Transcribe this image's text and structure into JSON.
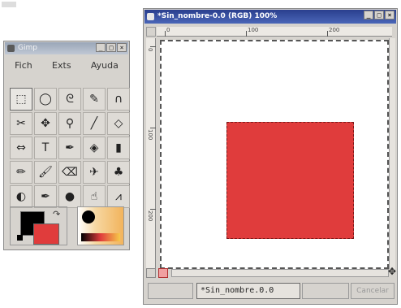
{
  "toolbox": {
    "title": "Gimp",
    "menu": [
      "Fich",
      "Exts",
      "Ayuda"
    ],
    "tools": [
      {
        "icon": "rect-select-icon",
        "glyph": "⬚"
      },
      {
        "icon": "ellipse-select-icon",
        "glyph": "◯"
      },
      {
        "icon": "free-select-icon",
        "glyph": "ᘓ"
      },
      {
        "icon": "fuzzy-select-icon",
        "glyph": "✎"
      },
      {
        "icon": "bezier-select-icon",
        "glyph": "∩"
      },
      {
        "icon": "scissors-icon",
        "glyph": "✂"
      },
      {
        "icon": "move-icon",
        "glyph": "✥"
      },
      {
        "icon": "magnify-icon",
        "glyph": "⚲"
      },
      {
        "icon": "crop-icon",
        "glyph": "╱"
      },
      {
        "icon": "transform-icon",
        "glyph": "◇"
      },
      {
        "icon": "flip-icon",
        "glyph": "⇔"
      },
      {
        "icon": "text-icon",
        "glyph": "T"
      },
      {
        "icon": "color-picker-icon",
        "glyph": "✒"
      },
      {
        "icon": "bucket-fill-icon",
        "glyph": "◈"
      },
      {
        "icon": "blend-icon",
        "glyph": "▮"
      },
      {
        "icon": "pencil-icon",
        "glyph": "✏"
      },
      {
        "icon": "paintbrush-icon",
        "glyph": "🖌"
      },
      {
        "icon": "eraser-icon",
        "glyph": "⌫"
      },
      {
        "icon": "airbrush-icon",
        "glyph": "✈"
      },
      {
        "icon": "clone-icon",
        "glyph": "♣"
      },
      {
        "icon": "convolve-icon",
        "glyph": "◐"
      },
      {
        "icon": "ink-icon",
        "glyph": "✒"
      },
      {
        "icon": "dodge-burn-icon",
        "glyph": "●"
      },
      {
        "icon": "smudge-icon",
        "glyph": "☝"
      },
      {
        "icon": "measure-icon",
        "glyph": "⩘"
      }
    ],
    "colors": {
      "foreground": "#000000",
      "background": "#e03c3c"
    }
  },
  "image_window": {
    "title": "*Sin_nombre-0.0 (RGB) 100%",
    "ruler_labels": [
      "0",
      "100",
      "200"
    ],
    "square_color": "#e03c3c",
    "status_text": "*Sin_nombre.0.0",
    "cancel_label": "Cancelar"
  }
}
